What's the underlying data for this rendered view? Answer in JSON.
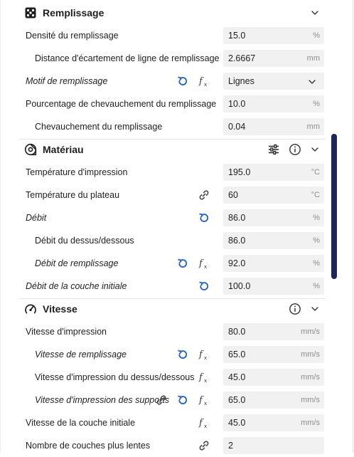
{
  "sections": [
    {
      "id": "infill",
      "title": "Remplissage",
      "icon": "infill-pattern-icon",
      "collapse_icon": "chevron-down-icon",
      "rows": [
        {
          "label": "Densité du remplissage",
          "value": "15.0",
          "unit": "%",
          "italic": false,
          "indent": 1,
          "icons": []
        },
        {
          "label": "Distance d'écartement de ligne de remplissage",
          "value": "2.6667",
          "unit": "mm",
          "italic": false,
          "indent": 2,
          "icons": []
        },
        {
          "label": "Motif de remplissage",
          "value": "Lignes",
          "unit": "",
          "italic": true,
          "indent": 1,
          "icons": [
            "reset-icon",
            "function-icon"
          ],
          "type": "select"
        },
        {
          "label": "Pourcentage de chevauchement du remplissage",
          "value": "10.0",
          "unit": "%",
          "italic": false,
          "indent": 1,
          "icons": []
        },
        {
          "label": "Chevauchement du remplissage",
          "value": "0.04",
          "unit": "mm",
          "italic": false,
          "indent": 2,
          "icons": []
        }
      ]
    },
    {
      "id": "material",
      "title": "Matériau",
      "icon": "material-spool-icon",
      "header_icons": [
        "settings-sliders-icon",
        "info-icon"
      ],
      "collapse_icon": "chevron-down-icon",
      "rows": [
        {
          "label": "Température d'impression",
          "value": "195.0",
          "unit": "°C",
          "italic": false,
          "indent": 1,
          "icons": []
        },
        {
          "label": "Température du plateau",
          "value": "60",
          "unit": "°C",
          "italic": false,
          "indent": 1,
          "icons": [
            "link-icon"
          ]
        },
        {
          "label": "Débit",
          "value": "86.0",
          "unit": "%",
          "italic": true,
          "indent": 1,
          "icons": [
            "reset-icon"
          ]
        },
        {
          "label": "Débit du dessus/dessous",
          "value": "86.0",
          "unit": "%",
          "italic": false,
          "indent": 2,
          "icons": []
        },
        {
          "label": "Débit de remplissage",
          "value": "92.0",
          "unit": "%",
          "italic": true,
          "indent": 2,
          "icons": [
            "reset-icon",
            "function-icon"
          ]
        },
        {
          "label": "Débit de la couche initiale",
          "value": "100.0",
          "unit": "%",
          "italic": true,
          "indent": 1,
          "icons": [
            "reset-icon"
          ]
        }
      ]
    },
    {
      "id": "speed",
      "title": "Vitesse",
      "icon": "speed-gauge-icon",
      "header_icons": [
        "info-icon"
      ],
      "collapse_icon": "chevron-down-icon",
      "rows": [
        {
          "label": "Vitesse d'impression",
          "value": "80.0",
          "unit": "mm/s",
          "italic": false,
          "indent": 1,
          "icons": []
        },
        {
          "label": "Vitesse de remplissage",
          "value": "65.0",
          "unit": "mm/s",
          "italic": true,
          "indent": 2,
          "icons": [
            "reset-icon",
            "function-icon"
          ]
        },
        {
          "label": "Vitesse d'impression du dessus/dessous",
          "value": "45.0",
          "unit": "mm/s",
          "italic": false,
          "indent": 2,
          "icons": [
            "function-icon"
          ]
        },
        {
          "label": "Vitesse d'impression des supports",
          "value": "65.0",
          "unit": "mm/s",
          "italic": true,
          "indent": 2,
          "icons": [
            "link-icon",
            "reset-icon",
            "function-icon"
          ]
        },
        {
          "label": "Vitesse de la couche initiale",
          "value": "45.0",
          "unit": "mm/s",
          "italic": false,
          "indent": 1,
          "icons": [
            "function-icon"
          ]
        },
        {
          "label": "Nombre de couches plus lentes",
          "value": "2",
          "unit": "",
          "italic": false,
          "indent": 1,
          "icons": [
            "link-icon"
          ]
        }
      ]
    }
  ],
  "colors": {
    "accent": "#1f63c6",
    "scrollbar": "#1f2558",
    "field_bg": "#f1f1f1",
    "unit_text": "#8c8c8c"
  }
}
